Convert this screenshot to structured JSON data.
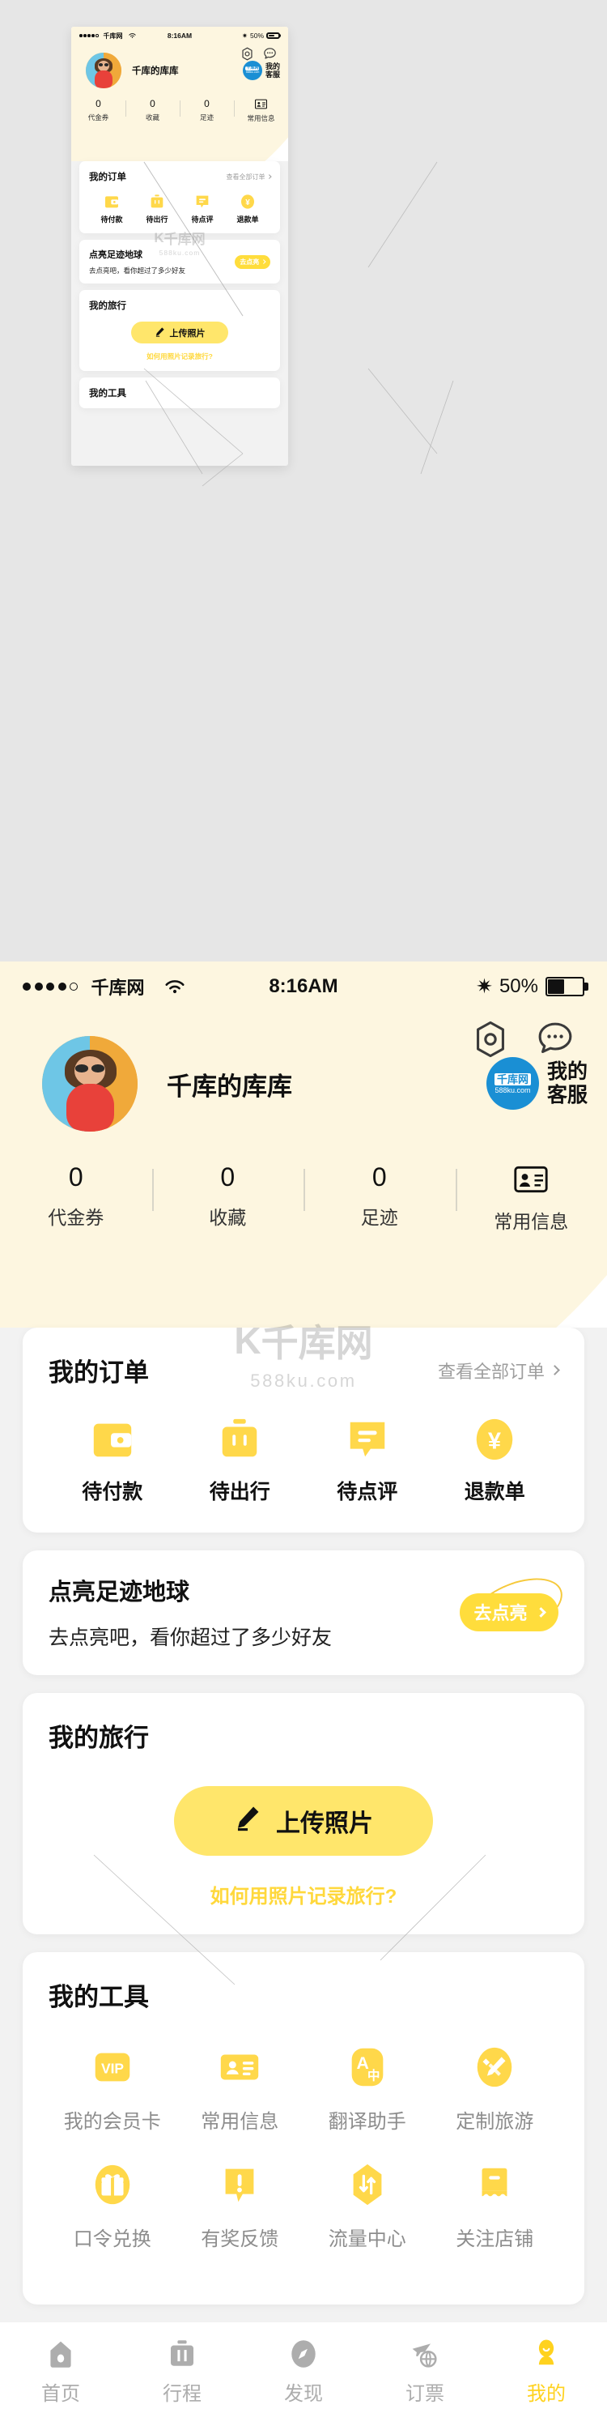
{
  "statusbar": {
    "signal_dots": 5,
    "carrier": "千库网",
    "wifi_icon": "wifi-icon",
    "time": "8:16AM",
    "bluetooth_icon": "bluetooth-icon",
    "battery_percent": "50%",
    "battery_icon": "battery-icon"
  },
  "header": {
    "settings_icon": "hex-gear-icon",
    "message_icon": "chat-bubble-icon",
    "username": "千库的库库",
    "avatar_icon": "user-avatar",
    "customer_service": {
      "logo_line1": "千库网",
      "logo_line2": "588ku.com",
      "label_line1": "我的",
      "label_line2": "客服"
    },
    "stats": [
      {
        "num": "0",
        "label": "代金券"
      },
      {
        "num": "0",
        "label": "收藏"
      },
      {
        "num": "0",
        "label": "足迹"
      },
      {
        "num": "",
        "label": "常用信息",
        "icon": "id-card-icon"
      }
    ]
  },
  "orders_card": {
    "title": "我的订单",
    "more_label": "查看全部订单",
    "items": [
      {
        "label": "待付款",
        "icon": "wallet-icon"
      },
      {
        "label": "待出行",
        "icon": "suitcase-icon"
      },
      {
        "label": "待点评",
        "icon": "comment-icon"
      },
      {
        "label": "退款单",
        "icon": "yuan-refund-icon"
      }
    ]
  },
  "glow_card": {
    "title": "点亮足迹地球",
    "subtitle": "去点亮吧，看你超过了多少好友",
    "button_label": "去点亮"
  },
  "travel_card": {
    "title": "我的旅行",
    "upload_label": "上传照片",
    "upload_icon": "pencil-icon",
    "help_link": "如何用照片记录旅行?"
  },
  "tools_card": {
    "title": "我的工具",
    "items": [
      {
        "label": "我的会员卡",
        "icon": "vip-card-icon",
        "glyph": "VIP"
      },
      {
        "label": "常用信息",
        "icon": "id-card-icon",
        "glyph": ""
      },
      {
        "label": "翻译助手",
        "icon": "translate-icon",
        "glyph": "A中"
      },
      {
        "label": "定制旅游",
        "icon": "pencil-ruler-icon",
        "glyph": ""
      },
      {
        "label": "口令兑换",
        "icon": "gift-icon",
        "glyph": ""
      },
      {
        "label": "有奖反馈",
        "icon": "exclamation-bubble-icon",
        "glyph": "!"
      },
      {
        "label": "流量中心",
        "icon": "data-flow-icon",
        "glyph": ""
      },
      {
        "label": "关注店铺",
        "icon": "shop-icon",
        "glyph": ""
      }
    ]
  },
  "tabbar": {
    "items": [
      {
        "label": "首页",
        "icon": "home-icon",
        "active": false
      },
      {
        "label": "行程",
        "icon": "suitcase-icon",
        "active": false
      },
      {
        "label": "发现",
        "icon": "compass-icon",
        "active": false
      },
      {
        "label": "订票",
        "icon": "plane-globe-icon",
        "active": false
      },
      {
        "label": "我的",
        "icon": "person-icon",
        "active": true
      }
    ]
  },
  "watermark": {
    "logo": "K",
    "text": "千库网",
    "url": "588ku.com"
  },
  "colors": {
    "header_cream": "#FDF6E0",
    "accent_yellow": "#FFD21E",
    "button_yellow": "#FFDD3C",
    "upload_yellow": "#FFE66B",
    "page_bg": "#F2F2F2",
    "outer_bg": "#E6E6E6",
    "muted_text": "#8D8D8D"
  }
}
